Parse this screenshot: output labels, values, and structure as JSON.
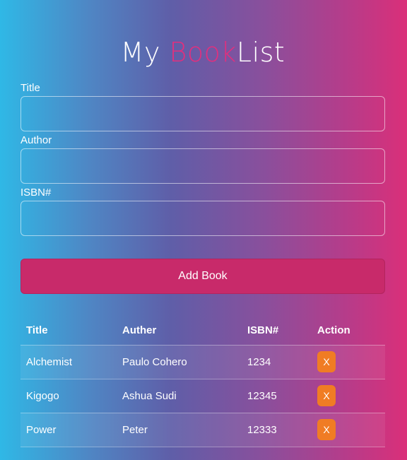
{
  "header": {
    "title_my": "My ",
    "title_book": "Book",
    "title_list": "List"
  },
  "form": {
    "title_label": "Title",
    "author_label": "Author",
    "isbn_label": "ISBN#",
    "title_value": "",
    "author_value": "",
    "isbn_value": "",
    "submit_label": "Add Book"
  },
  "table": {
    "headers": [
      "Title",
      "Auther",
      "ISBN#",
      "Action"
    ],
    "rows": [
      {
        "title": "Alchemist",
        "author": "Paulo Cohero",
        "isbn": "1234",
        "action": "X"
      },
      {
        "title": "Kigogo",
        "author": "Ashua Sudi",
        "isbn": "12345",
        "action": "X"
      },
      {
        "title": "Power",
        "author": "Peter",
        "isbn": "12333",
        "action": "X"
      }
    ]
  },
  "colors": {
    "accent": "#e0307e",
    "button": "#c82a6a",
    "delete": "#f07c24"
  }
}
